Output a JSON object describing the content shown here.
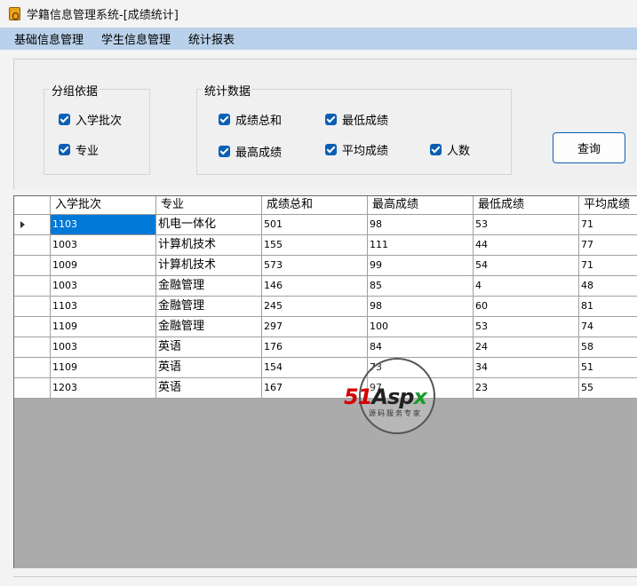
{
  "window": {
    "title": "学籍信息管理系统-[成绩统计]"
  },
  "menu": [
    "基础信息管理",
    "学生信息管理",
    "统计报表"
  ],
  "group_by": {
    "title": "分组依据",
    "options": [
      {
        "label": "入学批次",
        "checked": true
      },
      {
        "label": "专业",
        "checked": true
      }
    ]
  },
  "stats": {
    "title": "统计数据",
    "options": [
      {
        "label": "成绩总和",
        "checked": true
      },
      {
        "label": "最低成绩",
        "checked": true
      },
      {
        "label": "最高成绩",
        "checked": true
      },
      {
        "label": "平均成绩",
        "checked": true
      },
      {
        "label": "人数",
        "checked": true
      }
    ]
  },
  "query_button": "查询",
  "table": {
    "columns": [
      "入学批次",
      "专业",
      "成绩总和",
      "最高成绩",
      "最低成绩",
      "平均成绩"
    ],
    "rows": [
      [
        "1103",
        "机电一体化",
        "501",
        "98",
        "53",
        "71"
      ],
      [
        "1003",
        "计算机技术",
        "155",
        "111",
        "44",
        "77"
      ],
      [
        "1009",
        "计算机技术",
        "573",
        "99",
        "54",
        "71"
      ],
      [
        "1003",
        "金融管理",
        "146",
        "85",
        "4",
        "48"
      ],
      [
        "1103",
        "金融管理",
        "245",
        "98",
        "60",
        "81"
      ],
      [
        "1109",
        "金融管理",
        "297",
        "100",
        "53",
        "74"
      ],
      [
        "1003",
        "英语",
        "176",
        "84",
        "24",
        "58"
      ],
      [
        "1109",
        "英语",
        "154",
        "73",
        "34",
        "51"
      ],
      [
        "1203",
        "英语",
        "167",
        "97",
        "23",
        "55"
      ]
    ],
    "selected_row": 0
  },
  "watermark": {
    "logo_51": "51",
    "logo_asp": "Asp",
    "logo_x": "x",
    "subtitle": "源码服务专家"
  }
}
